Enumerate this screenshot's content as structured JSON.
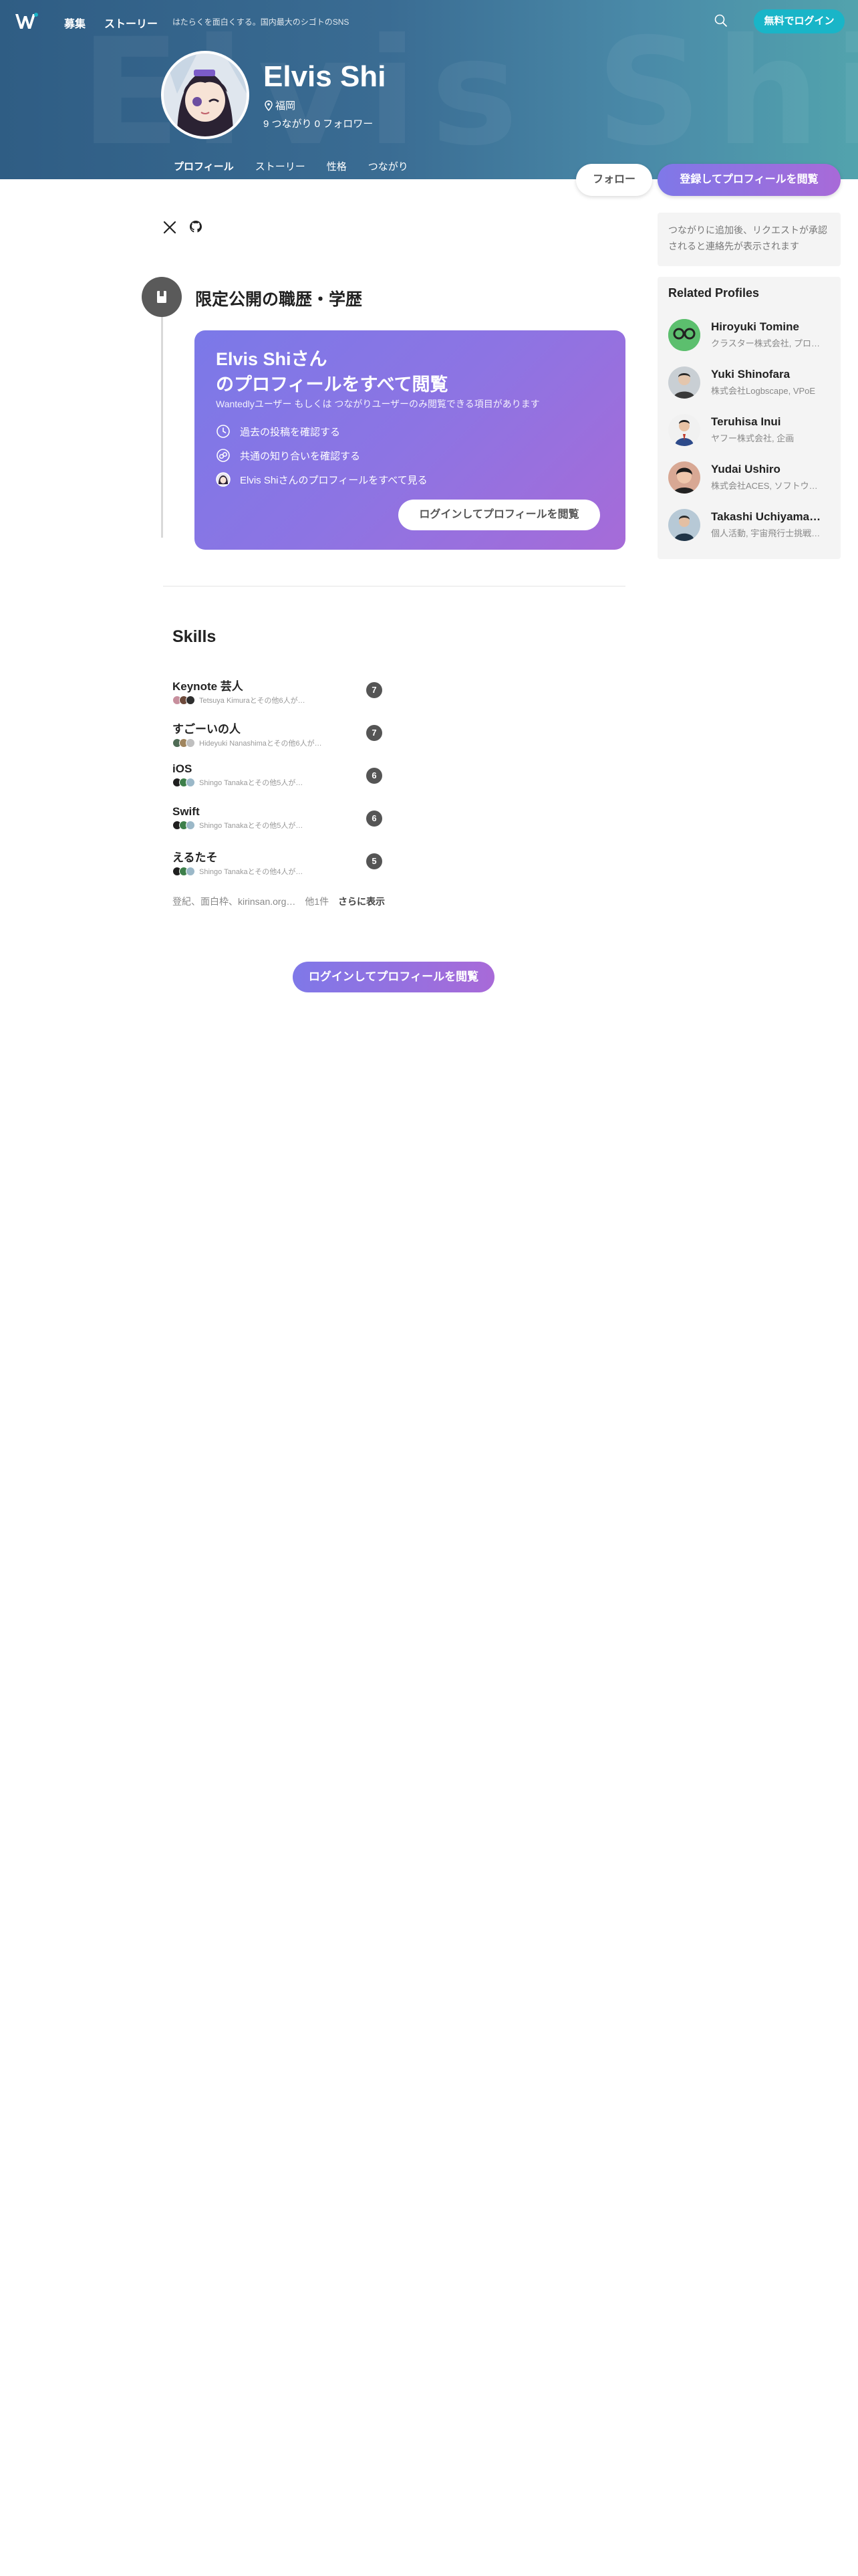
{
  "header": {
    "nav_recruit": "募集",
    "nav_stories": "ストーリー",
    "tagline": "はたらくを面白くする。国内最大のシゴトのSNS",
    "login_button": "無料でログイン",
    "watermark": "Elvis Shi"
  },
  "profile": {
    "name": "Elvis Shi",
    "location": "福岡",
    "stats": "9 つながり  0 フォロワー",
    "tabs": [
      "プロフィール",
      "ストーリー",
      "性格",
      "つながり"
    ],
    "follow_button": "フォロー",
    "register_button": "登録してプロフィールを閲覧"
  },
  "private_section": {
    "title": "限定公開の職歴・学歴",
    "card_title_line1": "Elvis Shiさん",
    "card_title_line2": "のプロフィールをすべて閲覧",
    "card_subtitle": "Wantedlyユーザー もしくは つながりユーザーのみ閲覧できる項目があります",
    "rows": [
      "過去の投稿を確認する",
      "共通の知り合いを確認する",
      "Elvis Shiさんのプロフィールをすべて見る"
    ],
    "card_button": "ログインしてプロフィールを閲覧"
  },
  "skills": {
    "title": "Skills",
    "items": [
      {
        "name": "Keynote 芸人",
        "endorse": "Tetsuya Kimuraとその他6人が…",
        "count": "7"
      },
      {
        "name": "すごーいの人",
        "endorse": "Hideyuki Nanashimaとその他6人が…",
        "count": "7"
      },
      {
        "name": "iOS",
        "endorse": "Shingo Tanakaとその他5人が…",
        "count": "6"
      },
      {
        "name": "Swift",
        "endorse": "Shingo Tanakaとその他5人が…",
        "count": "6"
      },
      {
        "name": "えるたそ",
        "endorse": "Shingo Tanakaとその他4人が…",
        "count": "5"
      }
    ],
    "more_text": "登紀、面白枠、kirinsan.org…　他1件",
    "more_link": "さらに表示"
  },
  "bottom_button": "ログインしてプロフィールを閲覧",
  "sidebar": {
    "note": "つながりに追加後、リクエストが承認されると連絡先が表示されます",
    "related_title": "Related Profiles",
    "profiles": [
      {
        "name": "Hiroyuki Tomine",
        "role": "クラスター株式会社, プロ…"
      },
      {
        "name": "Yuki Shinofara",
        "role": "株式会社Logbscape, VPoE"
      },
      {
        "name": "Teruhisa Inui",
        "role": "ヤフー株式会社, 企画"
      },
      {
        "name": "Yudai Ushiro",
        "role": "株式会社ACES, ソフトウ…"
      },
      {
        "name": "Takashi Uchiyama…",
        "role": "個人活動, 宇宙飛行士挑戦…"
      }
    ]
  },
  "colors": {
    "accent_teal": "#16b4c9",
    "purple_start": "#7f78e8",
    "purple_end": "#a86ad8"
  }
}
